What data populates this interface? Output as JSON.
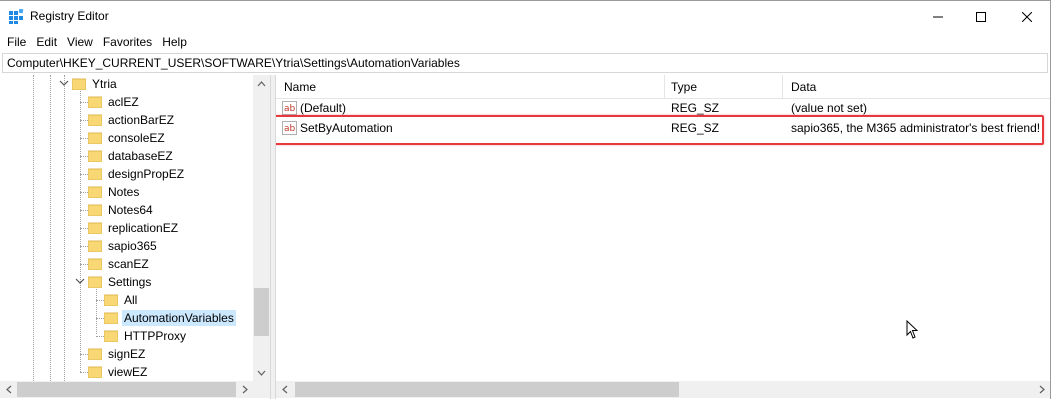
{
  "window": {
    "title": "Registry Editor"
  },
  "menu": {
    "items": [
      {
        "label": "File"
      },
      {
        "label": "Edit"
      },
      {
        "label": "View"
      },
      {
        "label": "Favorites"
      },
      {
        "label": "Help"
      }
    ]
  },
  "address": {
    "path": "Computer\\HKEY_CURRENT_USER\\SOFTWARE\\Ytria\\Settings\\AutomationVariables"
  },
  "tree": {
    "items": [
      {
        "label": "Ytria",
        "expanded": true
      },
      {
        "label": "aclEZ"
      },
      {
        "label": "actionBarEZ"
      },
      {
        "label": "consoleEZ"
      },
      {
        "label": "databaseEZ"
      },
      {
        "label": "designPropEZ"
      },
      {
        "label": "Notes"
      },
      {
        "label": "Notes64"
      },
      {
        "label": "replicationEZ"
      },
      {
        "label": "sapio365"
      },
      {
        "label": "scanEZ"
      },
      {
        "label": "Settings",
        "expanded": true
      },
      {
        "label": "All"
      },
      {
        "label": "AutomationVariables",
        "selected": true
      },
      {
        "label": "HTTPProxy"
      },
      {
        "label": "signEZ"
      },
      {
        "label": "viewEZ"
      }
    ]
  },
  "list": {
    "columns": [
      "Name",
      "Type",
      "Data"
    ],
    "rows": [
      {
        "name": "(Default)",
        "type": "REG_SZ",
        "data": "(value not set)"
      },
      {
        "name": "SetByAutomation",
        "type": "REG_SZ",
        "data": "sapio365, the M365 administrator's best friend!"
      }
    ]
  },
  "colors": {
    "selection": "#cce8ff",
    "highlight_border": "#e5393e",
    "folder": "#f8d775"
  }
}
